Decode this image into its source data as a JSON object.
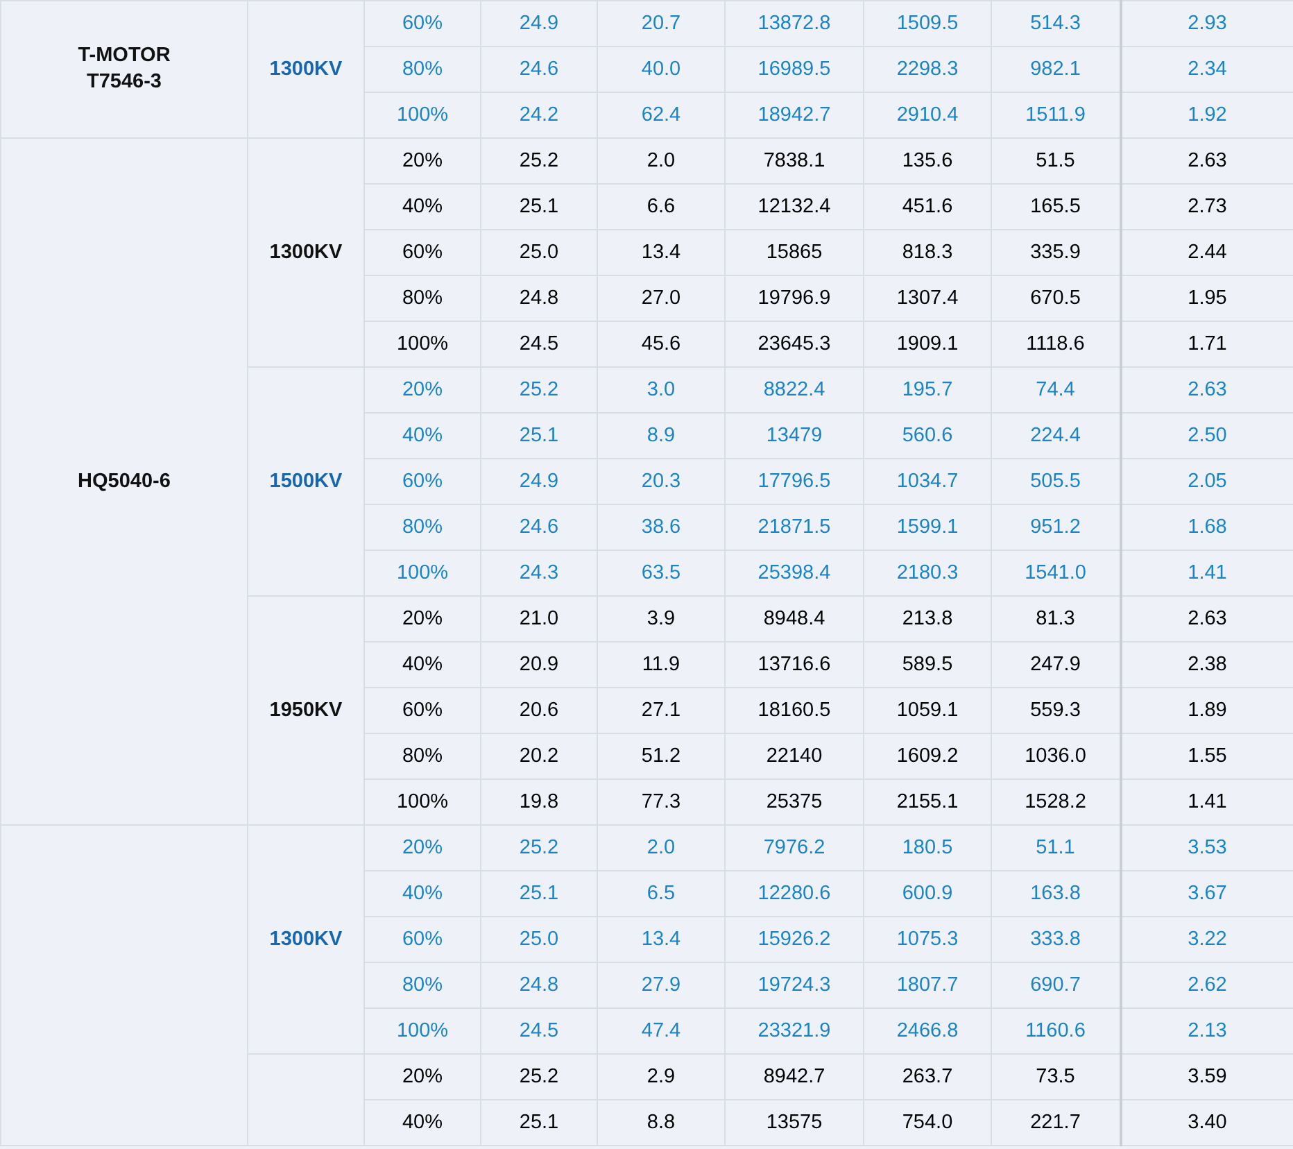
{
  "motors": [
    {
      "name": "T-MOTOR T7546-3",
      "kv_groups": [
        {
          "kv": "1300KV",
          "highlighted": true,
          "rows": [
            [
              "60%",
              "24.9",
              "20.7",
              "13872.8",
              "1509.5",
              "514.3",
              "2.93"
            ],
            [
              "80%",
              "24.6",
              "40.0",
              "16989.5",
              "2298.3",
              "982.1",
              "2.34"
            ],
            [
              "100%",
              "24.2",
              "62.4",
              "18942.7",
              "2910.4",
              "1511.9",
              "1.92"
            ]
          ]
        }
      ]
    },
    {
      "name": "HQ5040-6",
      "kv_groups": [
        {
          "kv": "1300KV",
          "highlighted": false,
          "rows": [
            [
              "20%",
              "25.2",
              "2.0",
              "7838.1",
              "135.6",
              "51.5",
              "2.63"
            ],
            [
              "40%",
              "25.1",
              "6.6",
              "12132.4",
              "451.6",
              "165.5",
              "2.73"
            ],
            [
              "60%",
              "25.0",
              "13.4",
              "15865",
              "818.3",
              "335.9",
              "2.44"
            ],
            [
              "80%",
              "24.8",
              "27.0",
              "19796.9",
              "1307.4",
              "670.5",
              "1.95"
            ],
            [
              "100%",
              "24.5",
              "45.6",
              "23645.3",
              "1909.1",
              "1118.6",
              "1.71"
            ]
          ]
        },
        {
          "kv": "1500KV",
          "highlighted": true,
          "rows": [
            [
              "20%",
              "25.2",
              "3.0",
              "8822.4",
              "195.7",
              "74.4",
              "2.63"
            ],
            [
              "40%",
              "25.1",
              "8.9",
              "13479",
              "560.6",
              "224.4",
              "2.50"
            ],
            [
              "60%",
              "24.9",
              "20.3",
              "17796.5",
              "1034.7",
              "505.5",
              "2.05"
            ],
            [
              "80%",
              "24.6",
              "38.6",
              "21871.5",
              "1599.1",
              "951.2",
              "1.68"
            ],
            [
              "100%",
              "24.3",
              "63.5",
              "25398.4",
              "2180.3",
              "1541.0",
              "1.41"
            ]
          ]
        },
        {
          "kv": "1950KV",
          "highlighted": false,
          "rows": [
            [
              "20%",
              "21.0",
              "3.9",
              "8948.4",
              "213.8",
              "81.3",
              "2.63"
            ],
            [
              "40%",
              "20.9",
              "11.9",
              "13716.6",
              "589.5",
              "247.9",
              "2.38"
            ],
            [
              "60%",
              "20.6",
              "27.1",
              "18160.5",
              "1059.1",
              "559.3",
              "1.89"
            ],
            [
              "80%",
              "20.2",
              "51.2",
              "22140",
              "1609.2",
              "1036.0",
              "1.55"
            ],
            [
              "100%",
              "19.8",
              "77.3",
              "25375",
              "2155.1",
              "1528.2",
              "1.41"
            ]
          ]
        }
      ]
    },
    {
      "kv_groups": [
        {
          "kv": "1300KV",
          "highlighted": true,
          "rows": [
            [
              "20%",
              "25.2",
              "2.0",
              "7976.2",
              "180.5",
              "51.1",
              "3.53"
            ],
            [
              "40%",
              "25.1",
              "6.5",
              "12280.6",
              "600.9",
              "163.8",
              "3.67"
            ],
            [
              "60%",
              "25.0",
              "13.4",
              "15926.2",
              "1075.3",
              "333.8",
              "3.22"
            ],
            [
              "80%",
              "24.8",
              "27.9",
              "19724.3",
              "1807.7",
              "690.7",
              "2.62"
            ],
            [
              "100%",
              "24.5",
              "47.4",
              "23321.9",
              "2466.8",
              "1160.6",
              "2.13"
            ]
          ]
        },
        {
          "highlighted": false,
          "rows": [
            [
              "20%",
              "25.2",
              "2.9",
              "8942.7",
              "263.7",
              "73.5",
              "3.59"
            ],
            [
              "40%",
              "25.1",
              "8.8",
              "13575",
              "754.0",
              "221.7",
              "3.40"
            ]
          ]
        }
      ]
    }
  ]
}
